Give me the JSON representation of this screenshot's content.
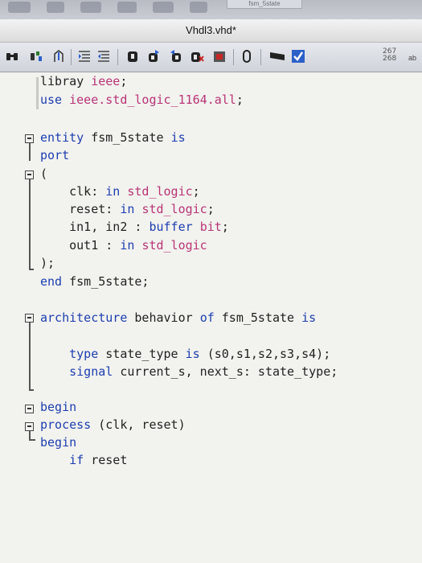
{
  "window": {
    "title": "Vhdl3.vhd*",
    "top_tab": "fsm_5state"
  },
  "toolbar": {
    "icons": [
      "binoculars-icon",
      "replace-icon",
      "goto-icon",
      "indent-icon",
      "outdent-icon",
      "bookmark-icon",
      "bookmark-next-icon",
      "bookmark-prev-icon",
      "bookmark-clear-icon",
      "clear-all-icon",
      "macro-icon",
      "record-icon",
      "check-icon"
    ],
    "line_count_top": "267",
    "line_count_bottom": "268",
    "ab_label": "ab"
  },
  "code": {
    "lines": [
      [
        {
          "t": "plain",
          "v": "libray "
        },
        {
          "t": "ty",
          "v": "ieee"
        },
        {
          "t": "plain",
          "v": ";"
        }
      ],
      [
        {
          "t": "kw",
          "v": "use "
        },
        {
          "t": "ty",
          "v": "ieee.std_logic_1164.all"
        },
        {
          "t": "plain",
          "v": ";"
        }
      ],
      [
        {
          "t": "kw",
          "v": "entity"
        },
        {
          "t": "plain",
          "v": " fsm_5state "
        },
        {
          "t": "kw",
          "v": "is"
        }
      ],
      [
        {
          "t": "kw",
          "v": "port"
        }
      ],
      [
        {
          "t": "plain",
          "v": "("
        }
      ],
      [
        {
          "t": "plain",
          "v": "    clk: "
        },
        {
          "t": "kw",
          "v": "in "
        },
        {
          "t": "ty",
          "v": "std_logic"
        },
        {
          "t": "plain",
          "v": ";"
        }
      ],
      [
        {
          "t": "plain",
          "v": "    reset: "
        },
        {
          "t": "kw",
          "v": "in "
        },
        {
          "t": "ty",
          "v": "std_logic"
        },
        {
          "t": "plain",
          "v": ";"
        }
      ],
      [
        {
          "t": "plain",
          "v": "    in1, in2 : "
        },
        {
          "t": "kw",
          "v": "buffer "
        },
        {
          "t": "ty",
          "v": "bit"
        },
        {
          "t": "plain",
          "v": ";"
        }
      ],
      [
        {
          "t": "plain",
          "v": "    out1 : "
        },
        {
          "t": "kw",
          "v": "in "
        },
        {
          "t": "ty",
          "v": "std_logic"
        }
      ],
      [
        {
          "t": "plain",
          "v": ");"
        }
      ],
      [
        {
          "t": "kw",
          "v": "end"
        },
        {
          "t": "plain",
          "v": " fsm_5state;"
        }
      ],
      [
        {
          "t": "kw",
          "v": "architecture"
        },
        {
          "t": "plain",
          "v": " behavior "
        },
        {
          "t": "kw",
          "v": "of"
        },
        {
          "t": "plain",
          "v": " fsm_5state "
        },
        {
          "t": "kw",
          "v": "is"
        }
      ],
      [
        {
          "t": "plain",
          "v": "    "
        },
        {
          "t": "kw",
          "v": "type"
        },
        {
          "t": "plain",
          "v": " state_type "
        },
        {
          "t": "kw",
          "v": "is"
        },
        {
          "t": "plain",
          "v": " (s0,s1,s2,s3,s4);"
        }
      ],
      [
        {
          "t": "plain",
          "v": "    "
        },
        {
          "t": "kw",
          "v": "signal"
        },
        {
          "t": "plain",
          "v": " current_s, next_s: state_type;"
        }
      ],
      [
        {
          "t": "kw",
          "v": "begin"
        }
      ],
      [
        {
          "t": "kw",
          "v": "process"
        },
        {
          "t": "plain",
          "v": " (clk, reset)"
        }
      ],
      [
        {
          "t": "kw",
          "v": "begin"
        }
      ],
      [
        {
          "t": "plain",
          "v": "    "
        },
        {
          "t": "kw",
          "v": "if"
        },
        {
          "t": "plain",
          "v": " reset"
        }
      ]
    ]
  },
  "colors": {
    "keyword": "#1d3fae",
    "type": "#b83575",
    "text": "#222222",
    "background": "#f2f2ef"
  }
}
